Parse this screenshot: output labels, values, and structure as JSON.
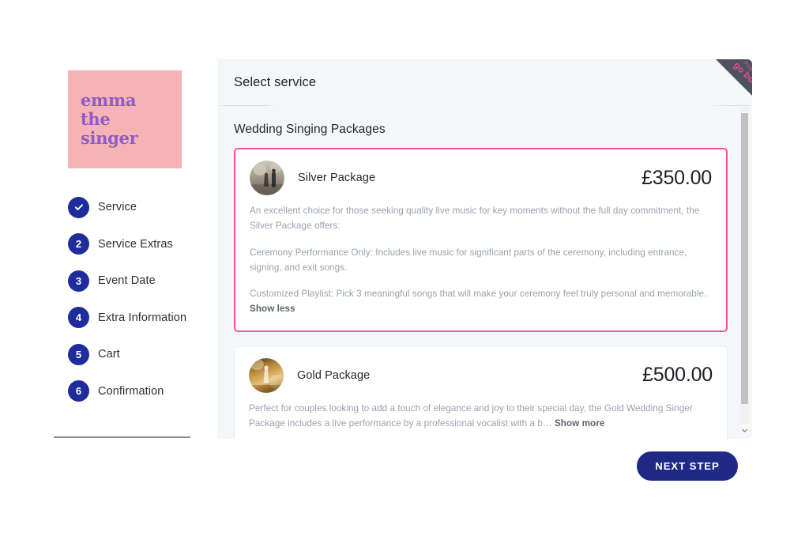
{
  "brand": {
    "logo_line1": "emma",
    "logo_line2": "the",
    "logo_line3": "singer",
    "logo_bg": "#f6b3b3",
    "logo_color": "#8e5cc8"
  },
  "ribbon": {
    "small": "Powered by",
    "big": "go book it",
    "band_color": "#4d525e",
    "text_color": "#ef4b96"
  },
  "sidebar": {
    "steps": [
      {
        "number": "1",
        "label": "Service",
        "state": "completed",
        "icon": "check-icon"
      },
      {
        "number": "2",
        "label": "Service Extras",
        "state": "upcoming"
      },
      {
        "number": "3",
        "label": "Event Date",
        "state": "upcoming"
      },
      {
        "number": "4",
        "label": "Extra Information",
        "state": "upcoming"
      },
      {
        "number": "5",
        "label": "Cart",
        "state": "upcoming"
      },
      {
        "number": "6",
        "label": "Confirmation",
        "state": "upcoming"
      }
    ],
    "badge_color": "#1f2d9c"
  },
  "header": {
    "title": "Select service"
  },
  "main": {
    "section_title": "Wedding Singing Packages",
    "selected_border_color": "#f5559e",
    "packages": [
      {
        "name": "Silver Package",
        "price": "£350.00",
        "selected": true,
        "thumb": "wedding-venue-photo",
        "paragraphs": [
          "An excellent choice for those seeking quality live music for key moments without the full day commitment, the Silver Package offers:",
          "Ceremony Performance Only: Includes live music for significant parts of the ceremony, including entrance, signing, and exit songs.",
          "Customized Playlist: Pick 3 meaningful songs that will make your ceremony feel truly personal and memorable."
        ],
        "toggle_label": "Show less"
      },
      {
        "name": "Gold Package",
        "price": "£500.00",
        "selected": false,
        "thumb": "gold-wedding-photo",
        "paragraphs": [
          "Perfect for couples looking to add a touch of elegance and joy to their special day, the Gold Wedding Singer Package includes a live performance by a professional vocalist with a b…"
        ],
        "toggle_label": "Show more"
      }
    ]
  },
  "footer": {
    "next_step_label": "NEXT STEP",
    "next_step_color": "#1e2a86"
  },
  "scrollbar": {
    "arrow_glyph": "▼"
  }
}
